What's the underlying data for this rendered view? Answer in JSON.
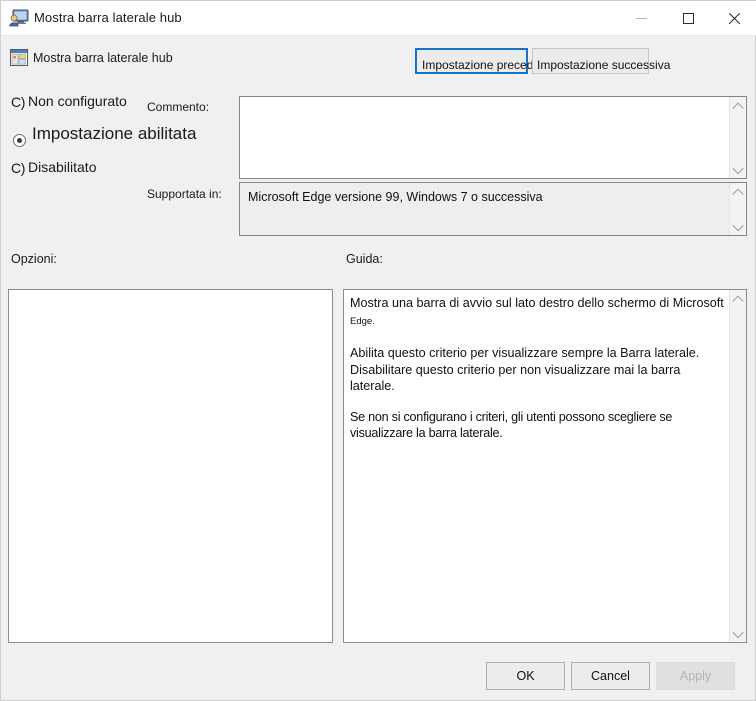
{
  "window": {
    "title": "Mostra barra laterale hub",
    "icons": {
      "title_icon": "monitor-user-icon",
      "policy_icon": "policy-window-icon",
      "minimize": "minimize-icon",
      "maximize": "maximize-icon",
      "close": "close-icon"
    }
  },
  "header": {
    "policy_name": "Mostra barra laterale hub",
    "prev_button": "Impostazione precedente",
    "next_button": "Impostazione successiva"
  },
  "state": {
    "not_configured": "Non configurato",
    "not_configured_marker": "C)",
    "enabled": "Impostazione abilitata",
    "disabled": "Disabilitato",
    "disabled_marker": "C)",
    "selected": "enabled"
  },
  "fields": {
    "comment_label": "Commento:",
    "comment_value": "",
    "supported_label": "Supportata in:",
    "supported_value": "Microsoft Edge versione 99, Windows 7 o successiva"
  },
  "panels": {
    "options_label": "Opzioni:",
    "help_label": "Guida:",
    "options_content": "",
    "help_paragraph_1_main": "Mostra una barra di avvio sul lato destro dello schermo di Microsoft ",
    "help_paragraph_1_tail": "Edge.",
    "help_paragraph_2": "Abilita questo criterio per visualizzare sempre la Barra laterale. Disabilitare questo criterio per non visualizzare mai la barra laterale.",
    "help_paragraph_3": "Se non si configurano i criteri, gli utenti possono scegliere se visualizzare la barra laterale."
  },
  "footer": {
    "ok": "OK",
    "cancel": "Cancel",
    "apply": "Apply",
    "apply_disabled": true
  },
  "colors": {
    "window_bg": "#f0f0f0",
    "titlebar_bg": "#ffffff",
    "focus_border": "#1673c8",
    "field_border": "#848484",
    "panel_border": "#8c8c8c",
    "disabled_text": "#b5b5b5"
  }
}
